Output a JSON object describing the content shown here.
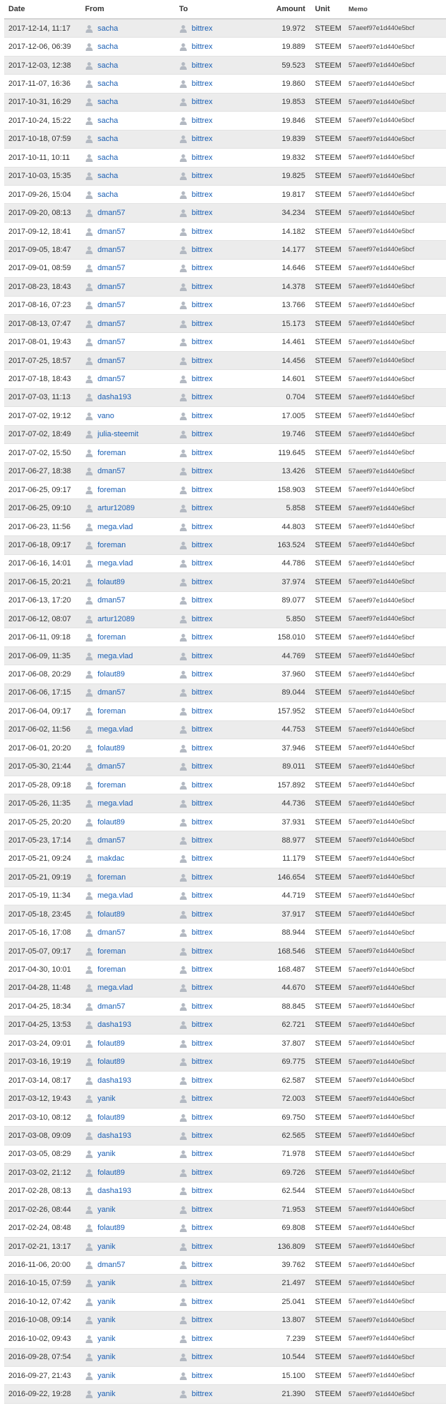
{
  "columns": {
    "date": "Date",
    "from": "From",
    "to": "To",
    "amount": "Amount",
    "unit": "Unit",
    "memo": "Memo"
  },
  "icon": "user-icon",
  "link_color": "#1a5fb4",
  "rows": [
    {
      "date": "2017-12-14, 11:17",
      "from": "sacha",
      "to": "bittrex",
      "amount": "19.972",
      "unit": "STEEM",
      "memo": "57aeef97e1d440e5bcf"
    },
    {
      "date": "2017-12-06, 06:39",
      "from": "sacha",
      "to": "bittrex",
      "amount": "19.889",
      "unit": "STEEM",
      "memo": "57aeef97e1d440e5bcf"
    },
    {
      "date": "2017-12-03, 12:38",
      "from": "sacha",
      "to": "bittrex",
      "amount": "59.523",
      "unit": "STEEM",
      "memo": "57aeef97e1d440e5bcf"
    },
    {
      "date": "2017-11-07, 16:36",
      "from": "sacha",
      "to": "bittrex",
      "amount": "19.860",
      "unit": "STEEM",
      "memo": "57aeef97e1d440e5bcf"
    },
    {
      "date": "2017-10-31, 16:29",
      "from": "sacha",
      "to": "bittrex",
      "amount": "19.853",
      "unit": "STEEM",
      "memo": "57aeef97e1d440e5bcf"
    },
    {
      "date": "2017-10-24, 15:22",
      "from": "sacha",
      "to": "bittrex",
      "amount": "19.846",
      "unit": "STEEM",
      "memo": "57aeef97e1d440e5bcf"
    },
    {
      "date": "2017-10-18, 07:59",
      "from": "sacha",
      "to": "bittrex",
      "amount": "19.839",
      "unit": "STEEM",
      "memo": "57aeef97e1d440e5bcf"
    },
    {
      "date": "2017-10-11, 10:11",
      "from": "sacha",
      "to": "bittrex",
      "amount": "19.832",
      "unit": "STEEM",
      "memo": "57aeef97e1d440e5bcf"
    },
    {
      "date": "2017-10-03, 15:35",
      "from": "sacha",
      "to": "bittrex",
      "amount": "19.825",
      "unit": "STEEM",
      "memo": "57aeef97e1d440e5bcf"
    },
    {
      "date": "2017-09-26, 15:04",
      "from": "sacha",
      "to": "bittrex",
      "amount": "19.817",
      "unit": "STEEM",
      "memo": "57aeef97e1d440e5bcf"
    },
    {
      "date": "2017-09-20, 08:13",
      "from": "dman57",
      "to": "bittrex",
      "amount": "34.234",
      "unit": "STEEM",
      "memo": "57aeef97e1d440e5bcf"
    },
    {
      "date": "2017-09-12, 18:41",
      "from": "dman57",
      "to": "bittrex",
      "amount": "14.182",
      "unit": "STEEM",
      "memo": "57aeef97e1d440e5bcf"
    },
    {
      "date": "2017-09-05, 18:47",
      "from": "dman57",
      "to": "bittrex",
      "amount": "14.177",
      "unit": "STEEM",
      "memo": "57aeef97e1d440e5bcf"
    },
    {
      "date": "2017-09-01, 08:59",
      "from": "dman57",
      "to": "bittrex",
      "amount": "14.646",
      "unit": "STEEM",
      "memo": "57aeef97e1d440e5bcf"
    },
    {
      "date": "2017-08-23, 18:43",
      "from": "dman57",
      "to": "bittrex",
      "amount": "14.378",
      "unit": "STEEM",
      "memo": "57aeef97e1d440e5bcf"
    },
    {
      "date": "2017-08-16, 07:23",
      "from": "dman57",
      "to": "bittrex",
      "amount": "13.766",
      "unit": "STEEM",
      "memo": "57aeef97e1d440e5bcf"
    },
    {
      "date": "2017-08-13, 07:47",
      "from": "dman57",
      "to": "bittrex",
      "amount": "15.173",
      "unit": "STEEM",
      "memo": "57aeef97e1d440e5bcf"
    },
    {
      "date": "2017-08-01, 19:43",
      "from": "dman57",
      "to": "bittrex",
      "amount": "14.461",
      "unit": "STEEM",
      "memo": "57aeef97e1d440e5bcf"
    },
    {
      "date": "2017-07-25, 18:57",
      "from": "dman57",
      "to": "bittrex",
      "amount": "14.456",
      "unit": "STEEM",
      "memo": "57aeef97e1d440e5bcf"
    },
    {
      "date": "2017-07-18, 18:43",
      "from": "dman57",
      "to": "bittrex",
      "amount": "14.601",
      "unit": "STEEM",
      "memo": "57aeef97e1d440e5bcf"
    },
    {
      "date": "2017-07-03, 11:13",
      "from": "dasha193",
      "to": "bittrex",
      "amount": "0.704",
      "unit": "STEEM",
      "memo": "57aeef97e1d440e5bcf"
    },
    {
      "date": "2017-07-02, 19:12",
      "from": "vano",
      "to": "bittrex",
      "amount": "17.005",
      "unit": "STEEM",
      "memo": "57aeef97e1d440e5bcf"
    },
    {
      "date": "2017-07-02, 18:49",
      "from": "julia-steemit",
      "to": "bittrex",
      "amount": "19.746",
      "unit": "STEEM",
      "memo": "57aeef97e1d440e5bcf"
    },
    {
      "date": "2017-07-02, 15:50",
      "from": "foreman",
      "to": "bittrex",
      "amount": "119.645",
      "unit": "STEEM",
      "memo": "57aeef97e1d440e5bcf"
    },
    {
      "date": "2017-06-27, 18:38",
      "from": "dman57",
      "to": "bittrex",
      "amount": "13.426",
      "unit": "STEEM",
      "memo": "57aeef97e1d440e5bcf"
    },
    {
      "date": "2017-06-25, 09:17",
      "from": "foreman",
      "to": "bittrex",
      "amount": "158.903",
      "unit": "STEEM",
      "memo": "57aeef97e1d440e5bcf"
    },
    {
      "date": "2017-06-25, 09:10",
      "from": "artur12089",
      "to": "bittrex",
      "amount": "5.858",
      "unit": "STEEM",
      "memo": "57aeef97e1d440e5bcf"
    },
    {
      "date": "2017-06-23, 11:56",
      "from": "mega.vlad",
      "to": "bittrex",
      "amount": "44.803",
      "unit": "STEEM",
      "memo": "57aeef97e1d440e5bcf"
    },
    {
      "date": "2017-06-18, 09:17",
      "from": "foreman",
      "to": "bittrex",
      "amount": "163.524",
      "unit": "STEEM",
      "memo": "57aeef97e1d440e5bcf"
    },
    {
      "date": "2017-06-16, 14:01",
      "from": "mega.vlad",
      "to": "bittrex",
      "amount": "44.786",
      "unit": "STEEM",
      "memo": "57aeef97e1d440e5bcf"
    },
    {
      "date": "2017-06-15, 20:21",
      "from": "folaut89",
      "to": "bittrex",
      "amount": "37.974",
      "unit": "STEEM",
      "memo": "57aeef97e1d440e5bcf"
    },
    {
      "date": "2017-06-13, 17:20",
      "from": "dman57",
      "to": "bittrex",
      "amount": "89.077",
      "unit": "STEEM",
      "memo": "57aeef97e1d440e5bcf"
    },
    {
      "date": "2017-06-12, 08:07",
      "from": "artur12089",
      "to": "bittrex",
      "amount": "5.850",
      "unit": "STEEM",
      "memo": "57aeef97e1d440e5bcf"
    },
    {
      "date": "2017-06-11, 09:18",
      "from": "foreman",
      "to": "bittrex",
      "amount": "158.010",
      "unit": "STEEM",
      "memo": "57aeef97e1d440e5bcf"
    },
    {
      "date": "2017-06-09, 11:35",
      "from": "mega.vlad",
      "to": "bittrex",
      "amount": "44.769",
      "unit": "STEEM",
      "memo": "57aeef97e1d440e5bcf"
    },
    {
      "date": "2017-06-08, 20:29",
      "from": "folaut89",
      "to": "bittrex",
      "amount": "37.960",
      "unit": "STEEM",
      "memo": "57aeef97e1d440e5bcf"
    },
    {
      "date": "2017-06-06, 17:15",
      "from": "dman57",
      "to": "bittrex",
      "amount": "89.044",
      "unit": "STEEM",
      "memo": "57aeef97e1d440e5bcf"
    },
    {
      "date": "2017-06-04, 09:17",
      "from": "foreman",
      "to": "bittrex",
      "amount": "157.952",
      "unit": "STEEM",
      "memo": "57aeef97e1d440e5bcf"
    },
    {
      "date": "2017-06-02, 11:56",
      "from": "mega.vlad",
      "to": "bittrex",
      "amount": "44.753",
      "unit": "STEEM",
      "memo": "57aeef97e1d440e5bcf"
    },
    {
      "date": "2017-06-01, 20:20",
      "from": "folaut89",
      "to": "bittrex",
      "amount": "37.946",
      "unit": "STEEM",
      "memo": "57aeef97e1d440e5bcf"
    },
    {
      "date": "2017-05-30, 21:44",
      "from": "dman57",
      "to": "bittrex",
      "amount": "89.011",
      "unit": "STEEM",
      "memo": "57aeef97e1d440e5bcf"
    },
    {
      "date": "2017-05-28, 09:18",
      "from": "foreman",
      "to": "bittrex",
      "amount": "157.892",
      "unit": "STEEM",
      "memo": "57aeef97e1d440e5bcf"
    },
    {
      "date": "2017-05-26, 11:35",
      "from": "mega.vlad",
      "to": "bittrex",
      "amount": "44.736",
      "unit": "STEEM",
      "memo": "57aeef97e1d440e5bcf"
    },
    {
      "date": "2017-05-25, 20:20",
      "from": "folaut89",
      "to": "bittrex",
      "amount": "37.931",
      "unit": "STEEM",
      "memo": "57aeef97e1d440e5bcf"
    },
    {
      "date": "2017-05-23, 17:14",
      "from": "dman57",
      "to": "bittrex",
      "amount": "88.977",
      "unit": "STEEM",
      "memo": "57aeef97e1d440e5bcf"
    },
    {
      "date": "2017-05-21, 09:24",
      "from": "makdac",
      "to": "bittrex",
      "amount": "11.179",
      "unit": "STEEM",
      "memo": "57aeef97e1d440e5bcf"
    },
    {
      "date": "2017-05-21, 09:19",
      "from": "foreman",
      "to": "bittrex",
      "amount": "146.654",
      "unit": "STEEM",
      "memo": "57aeef97e1d440e5bcf"
    },
    {
      "date": "2017-05-19, 11:34",
      "from": "mega.vlad",
      "to": "bittrex",
      "amount": "44.719",
      "unit": "STEEM",
      "memo": "57aeef97e1d440e5bcf"
    },
    {
      "date": "2017-05-18, 23:45",
      "from": "folaut89",
      "to": "bittrex",
      "amount": "37.917",
      "unit": "STEEM",
      "memo": "57aeef97e1d440e5bcf"
    },
    {
      "date": "2017-05-16, 17:08",
      "from": "dman57",
      "to": "bittrex",
      "amount": "88.944",
      "unit": "STEEM",
      "memo": "57aeef97e1d440e5bcf"
    },
    {
      "date": "2017-05-07, 09:17",
      "from": "foreman",
      "to": "bittrex",
      "amount": "168.546",
      "unit": "STEEM",
      "memo": "57aeef97e1d440e5bcf"
    },
    {
      "date": "2017-04-30, 10:01",
      "from": "foreman",
      "to": "bittrex",
      "amount": "168.487",
      "unit": "STEEM",
      "memo": "57aeef97e1d440e5bcf"
    },
    {
      "date": "2017-04-28, 11:48",
      "from": "mega.vlad",
      "to": "bittrex",
      "amount": "44.670",
      "unit": "STEEM",
      "memo": "57aeef97e1d440e5bcf"
    },
    {
      "date": "2017-04-25, 18:34",
      "from": "dman57",
      "to": "bittrex",
      "amount": "88.845",
      "unit": "STEEM",
      "memo": "57aeef97e1d440e5bcf"
    },
    {
      "date": "2017-04-25, 13:53",
      "from": "dasha193",
      "to": "bittrex",
      "amount": "62.721",
      "unit": "STEEM",
      "memo": "57aeef97e1d440e5bcf"
    },
    {
      "date": "2017-03-24, 09:01",
      "from": "folaut89",
      "to": "bittrex",
      "amount": "37.807",
      "unit": "STEEM",
      "memo": "57aeef97e1d440e5bcf"
    },
    {
      "date": "2017-03-16, 19:19",
      "from": "folaut89",
      "to": "bittrex",
      "amount": "69.775",
      "unit": "STEEM",
      "memo": "57aeef97e1d440e5bcf"
    },
    {
      "date": "2017-03-14, 08:17",
      "from": "dasha193",
      "to": "bittrex",
      "amount": "62.587",
      "unit": "STEEM",
      "memo": "57aeef97e1d440e5bcf"
    },
    {
      "date": "2017-03-12, 19:43",
      "from": "yanik",
      "to": "bittrex",
      "amount": "72.003",
      "unit": "STEEM",
      "memo": "57aeef97e1d440e5bcf"
    },
    {
      "date": "2017-03-10, 08:12",
      "from": "folaut89",
      "to": "bittrex",
      "amount": "69.750",
      "unit": "STEEM",
      "memo": "57aeef97e1d440e5bcf"
    },
    {
      "date": "2017-03-08, 09:09",
      "from": "dasha193",
      "to": "bittrex",
      "amount": "62.565",
      "unit": "STEEM",
      "memo": "57aeef97e1d440e5bcf"
    },
    {
      "date": "2017-03-05, 08:29",
      "from": "yanik",
      "to": "bittrex",
      "amount": "71.978",
      "unit": "STEEM",
      "memo": "57aeef97e1d440e5bcf"
    },
    {
      "date": "2017-03-02, 21:12",
      "from": "folaut89",
      "to": "bittrex",
      "amount": "69.726",
      "unit": "STEEM",
      "memo": "57aeef97e1d440e5bcf"
    },
    {
      "date": "2017-02-28, 08:13",
      "from": "dasha193",
      "to": "bittrex",
      "amount": "62.544",
      "unit": "STEEM",
      "memo": "57aeef97e1d440e5bcf"
    },
    {
      "date": "2017-02-26, 08:44",
      "from": "yanik",
      "to": "bittrex",
      "amount": "71.953",
      "unit": "STEEM",
      "memo": "57aeef97e1d440e5bcf"
    },
    {
      "date": "2017-02-24, 08:48",
      "from": "folaut89",
      "to": "bittrex",
      "amount": "69.808",
      "unit": "STEEM",
      "memo": "57aeef97e1d440e5bcf"
    },
    {
      "date": "2017-02-21, 13:17",
      "from": "yanik",
      "to": "bittrex",
      "amount": "136.809",
      "unit": "STEEM",
      "memo": "57aeef97e1d440e5bcf"
    },
    {
      "date": "2016-11-06, 20:00",
      "from": "dman57",
      "to": "bittrex",
      "amount": "39.762",
      "unit": "STEEM",
      "memo": "57aeef97e1d440e5bcf"
    },
    {
      "date": "2016-10-15, 07:59",
      "from": "yanik",
      "to": "bittrex",
      "amount": "21.497",
      "unit": "STEEM",
      "memo": "57aeef97e1d440e5bcf"
    },
    {
      "date": "2016-10-12, 07:42",
      "from": "yanik",
      "to": "bittrex",
      "amount": "25.041",
      "unit": "STEEM",
      "memo": "57aeef97e1d440e5bcf"
    },
    {
      "date": "2016-10-08, 09:14",
      "from": "yanik",
      "to": "bittrex",
      "amount": "13.807",
      "unit": "STEEM",
      "memo": "57aeef97e1d440e5bcf"
    },
    {
      "date": "2016-10-02, 09:43",
      "from": "yanik",
      "to": "bittrex",
      "amount": "7.239",
      "unit": "STEEM",
      "memo": "57aeef97e1d440e5bcf"
    },
    {
      "date": "2016-09-28, 07:54",
      "from": "yanik",
      "to": "bittrex",
      "amount": "10.544",
      "unit": "STEEM",
      "memo": "57aeef97e1d440e5bcf"
    },
    {
      "date": "2016-09-27, 21:43",
      "from": "yanik",
      "to": "bittrex",
      "amount": "15.100",
      "unit": "STEEM",
      "memo": "57aeef97e1d440e5bcf"
    },
    {
      "date": "2016-09-22, 19:28",
      "from": "yanik",
      "to": "bittrex",
      "amount": "21.390",
      "unit": "STEEM",
      "memo": "57aeef97e1d440e5bcf"
    }
  ]
}
